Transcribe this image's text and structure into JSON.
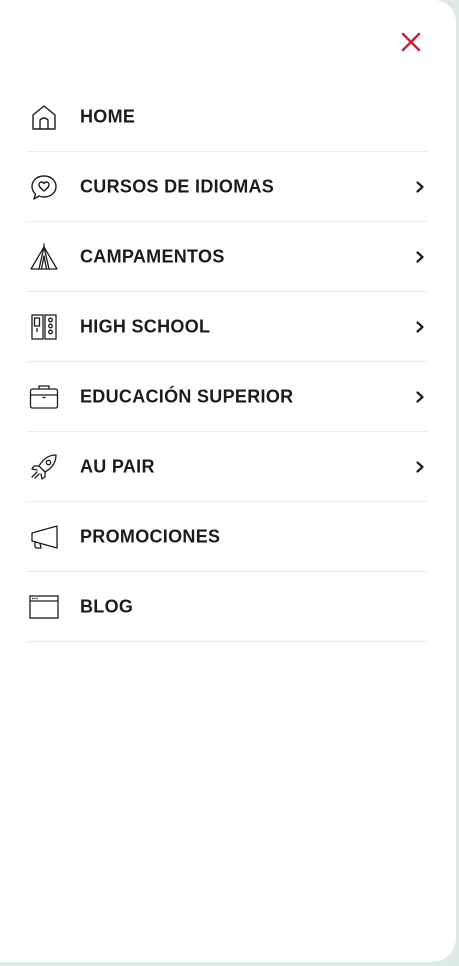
{
  "colors": {
    "close": "#c0283a",
    "text": "#1c1c1c",
    "divider": "#e8ecec",
    "background": "#dcece4"
  },
  "menu": {
    "items": [
      {
        "label": "HOME",
        "icon": "home-icon",
        "has_submenu": false
      },
      {
        "label": "CURSOS DE IDIOMAS",
        "icon": "speech-heart-icon",
        "has_submenu": true
      },
      {
        "label": "CAMPAMENTOS",
        "icon": "tent-icon",
        "has_submenu": true
      },
      {
        "label": "HIGH SCHOOL",
        "icon": "lockers-icon",
        "has_submenu": true
      },
      {
        "label": "EDUCACIÓN SUPERIOR",
        "icon": "briefcase-icon",
        "has_submenu": true
      },
      {
        "label": "AU PAIR",
        "icon": "rocket-icon",
        "has_submenu": true
      },
      {
        "label": "PROMOCIONES",
        "icon": "megaphone-icon",
        "has_submenu": false
      },
      {
        "label": "BLOG",
        "icon": "browser-window-icon",
        "has_submenu": false
      }
    ]
  }
}
